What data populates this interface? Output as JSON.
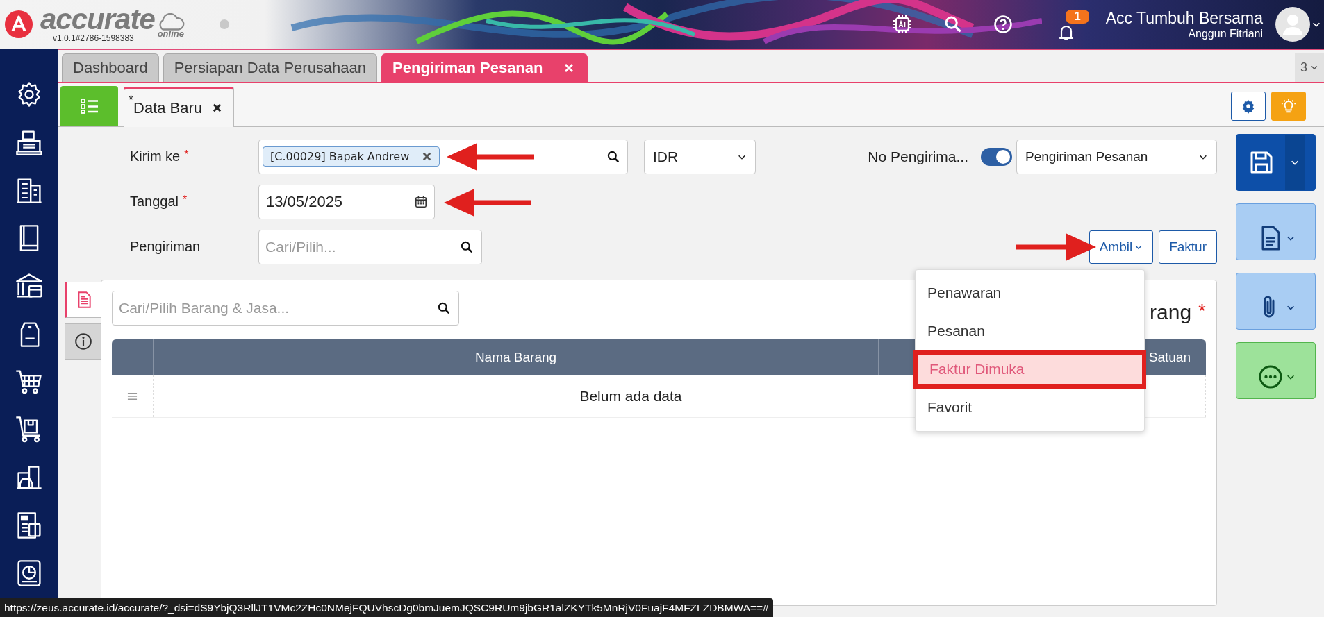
{
  "header": {
    "logo_text": "accurate",
    "logo_sub": "online",
    "version": "v1.0.1#2786-1598383",
    "notification_count": "1",
    "company": "Acc Tumbuh Bersama",
    "user": "Anggun Fitriani"
  },
  "tabs": [
    {
      "label": "Dashboard",
      "selected": false,
      "closable": false
    },
    {
      "label": "Persiapan Data Perusahaan",
      "selected": false,
      "closable": false
    },
    {
      "label": "Pengiriman Pesanan",
      "selected": true,
      "closable": true
    }
  ],
  "tab_count": "3",
  "doc_tabs": [
    {
      "mark": "*",
      "label": "Data Baru",
      "selected": true
    }
  ],
  "form": {
    "customer": {
      "label": "Kirim ke",
      "required_mark": "*",
      "value": "[C.00029] Bapak Andrew"
    },
    "currency": {
      "value": "IDR"
    },
    "number": {
      "label": "No Pengirima...",
      "auto": true,
      "type": "Pengiriman Pesanan"
    },
    "date": {
      "label": "Tanggal",
      "required_mark": "*",
      "value": "13/05/2025"
    },
    "shipment": {
      "label": "Pengiriman",
      "placeholder": "Cari/Pilih..."
    }
  },
  "buttons": [
    {
      "label": "Ambil",
      "kind": "dropdown"
    },
    {
      "label": "Faktur",
      "kind": "plain"
    }
  ],
  "menu": {
    "items": [
      {
        "label": "Penawaran",
        "selected": false
      },
      {
        "label": "Pesanan",
        "selected": false
      },
      {
        "label": "Faktur Dimuka",
        "selected": true
      },
      {
        "label": "Favorit",
        "selected": false
      }
    ]
  },
  "panel": {
    "side_tabs": [
      {
        "kind": "document",
        "selected": true
      },
      {
        "kind": "info",
        "selected": false
      }
    ],
    "search_placeholder": "Cari/Pilih Barang & Jasa...",
    "title": "rang",
    "title_mark": "*",
    "table": {
      "columns": [
        {},
        {
          "label": "Nama Barang"
        },
        {},
        {
          "label": "Satuan"
        }
      ],
      "empty_text": "Belum ada data"
    }
  },
  "status_bar": {
    "url": "https://zeus.accurate.id/accurate/?_dsi=dS9YbjQ3RllJT1VMc2ZHc0NMejFQUVhscDg0bmJuemJQSC9RUm9jbGR1alZKYTk5MnRjV0FuajF4MFZLZDBMWA==#"
  }
}
